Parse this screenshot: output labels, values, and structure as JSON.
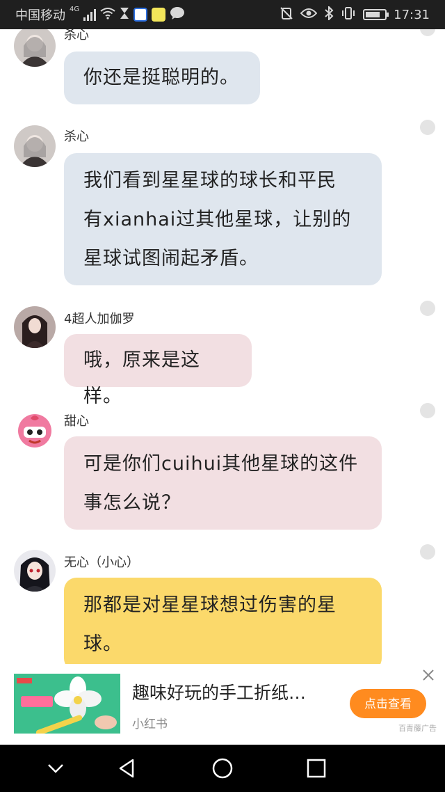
{
  "status_bar": {
    "carrier": "中国移动",
    "network": "4G",
    "time": "17:31",
    "battery_level": 0.75
  },
  "messages": [
    {
      "sender": "杀心",
      "lines": [
        "你还是挺聪明的。"
      ],
      "bubble_color": "#dfe6ee"
    },
    {
      "sender": "杀心",
      "lines": [
        "我们看到星星球的球长和平民",
        "有xianhai过其他星球，让别的",
        "星球试图闹起矛盾。"
      ],
      "bubble_color": "#dfe6ee"
    },
    {
      "sender": "4超人加伽罗",
      "lines": [
        "哦，原来是这样。"
      ],
      "bubble_color": "#f2dfe2"
    },
    {
      "sender": "甜心",
      "lines": [
        "可是你们cuihui其他星球的这件",
        "事怎么说？"
      ],
      "bubble_color": "#f2dfe2"
    },
    {
      "sender": "无心（小心）",
      "lines": [
        "那都是对星星球想过伤害的星",
        "球。"
      ],
      "bubble_color": "#fbd96b"
    }
  ],
  "ad": {
    "title": "趣味好玩的手工折纸…",
    "source": "小红书",
    "button_label": "点击查看",
    "tag": "百青藤广告",
    "close_icon": "close-icon",
    "accent_color": "#ff8b1f"
  },
  "nav": {
    "icons": [
      "chevron-down-icon",
      "back-triangle-icon",
      "home-circle-icon",
      "recents-square-icon"
    ]
  }
}
